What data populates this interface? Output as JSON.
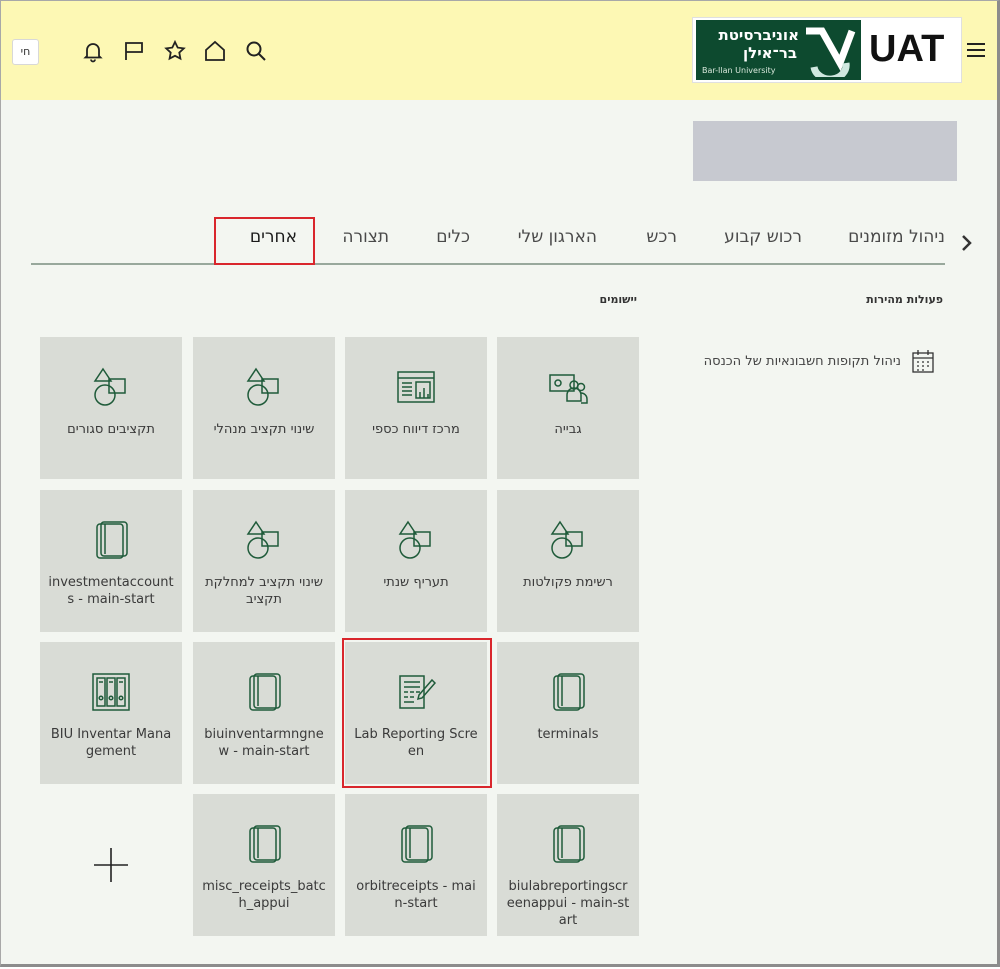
{
  "header": {
    "user_initials": "חי",
    "logo": {
      "university_line1": "אוניברסיטת",
      "university_line2": "בר־אילן",
      "university_en": "Bar-Ilan University",
      "env": "UAT"
    },
    "icons": [
      "bell-icon",
      "flag-icon",
      "star-icon",
      "home-icon",
      "search-icon",
      "hamburger-menu-icon"
    ]
  },
  "tabs": [
    {
      "label": "ניהול מזומנים"
    },
    {
      "label": "רכוש קבוע"
    },
    {
      "label": "רכש"
    },
    {
      "label": "הארגון שלי"
    },
    {
      "label": "כלים"
    },
    {
      "label": "תצורה"
    },
    {
      "label": "אחרים",
      "active": true
    }
  ],
  "quick_actions": {
    "title": "פעולות מהירות",
    "items": [
      {
        "label": "ניהול תקופות חשבונאיות של הכנסה",
        "icon": "calendar-icon"
      }
    ]
  },
  "apps": {
    "title": "יישומים",
    "tiles": [
      {
        "label": "גבייה",
        "icon": "people-money-icon"
      },
      {
        "label": "מרכז דיווח כספי",
        "icon": "report-dashboard-icon"
      },
      {
        "label": "שינוי תקציב מנהלי",
        "icon": "shapes-icon"
      },
      {
        "label": "תקציבים סגורים",
        "icon": "shapes-icon"
      },
      {
        "label": "רשימת פקולטות",
        "icon": "shapes-icon"
      },
      {
        "label": "תעריף שנתי",
        "icon": "shapes-icon"
      },
      {
        "label": "שינוי תקציב למחלקת תקציב",
        "icon": "shapes-icon"
      },
      {
        "label": "investmentaccounts - main-start",
        "icon": "book-icon"
      },
      {
        "label": "terminals",
        "icon": "book-icon"
      },
      {
        "label": "Lab Reporting Screen",
        "icon": "form-edit-icon",
        "highlighted": true
      },
      {
        "label": "biuinventarmngnew - main-start",
        "icon": "book-icon"
      },
      {
        "label": "BIU Inventar Management",
        "icon": "binders-icon"
      },
      {
        "label": "biulabreportingscreenappui - main-start",
        "icon": "book-icon"
      },
      {
        "label": "orbitreceipts - main-start",
        "icon": "book-icon"
      },
      {
        "label": "misc_receipts_batch_appui",
        "icon": "book-icon"
      },
      {
        "label": "",
        "icon": "plus-icon"
      }
    ]
  },
  "colors": {
    "header_bg": "#fdf8b4",
    "page_bg": "#f3f6f1",
    "tile_bg": "#d9dcd6",
    "icon_green": "#1f5b3a",
    "highlight": "#d9262c"
  }
}
